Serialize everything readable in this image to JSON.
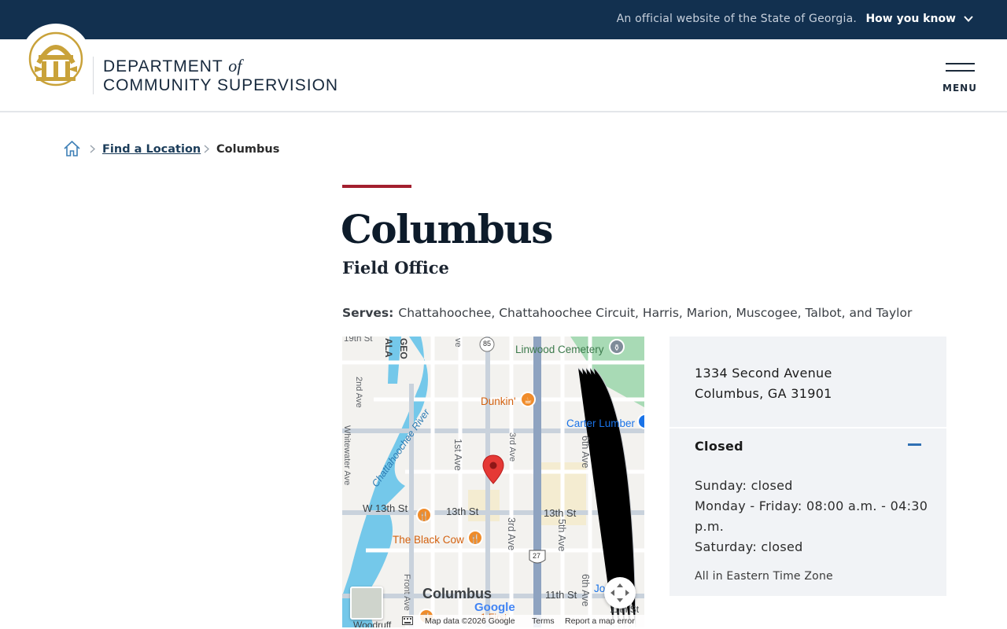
{
  "banner": {
    "official_text": "An official website of the State of Georgia.",
    "how_you_know": "How you know",
    "background_color": "#12304f"
  },
  "header": {
    "dept_line1": "DEPARTMENT",
    "dept_of": "of",
    "dept_line2": "COMMUNITY SUPERVISION",
    "menu_label": "MENU",
    "logo_icon": "georgia-seal-arch-icon"
  },
  "breadcrumb": {
    "home_icon": "home-icon",
    "find_location": "Find a Location",
    "current": "Columbus"
  },
  "page": {
    "title": "Columbus",
    "subtitle": "Field Office",
    "serves_label": "Serves:",
    "serves_value": "Chattahoochee, Chattahoochee Circuit, Harris, Marion, Muscogee, Talbot, and Taylor",
    "accent_color": "#a31f2e"
  },
  "map": {
    "labels": {
      "st19": "19th St",
      "linwood": "Linwood Cemetery",
      "dunkin": "Dunkin'",
      "carter": "Carter Lumber",
      "river": "Chattahoochee River",
      "whitewater": "Whitewater Ave",
      "ave2": "2nd Ave",
      "ave1": "1st Ave",
      "ave3a": "3rd Ave",
      "ave3b": "3rd Ave",
      "ave5": "5th Ave",
      "ave6a": "6th Ave",
      "ave6b": "6th Ave",
      "w13": "W 13th St",
      "st13a": "13th St",
      "st13b": "13th St",
      "blackcow": "The Black Cow",
      "front": "Front Ave",
      "st11a": "11th St",
      "st11b": "11th St",
      "city": "Columbus",
      "john": "Jo",
      "alabama": "ALA",
      "geo": "GEO",
      "ave_top": "ve",
      "route85": "85",
      "route27": "27",
      "woodruff": "Woodruff",
      "frst": "1 First"
    },
    "google_logo": "Google",
    "attribution": {
      "data": "Map data ©2026 Google",
      "terms": "Terms",
      "report": "Report a map error"
    },
    "pin_icon": "location-pin-icon"
  },
  "location": {
    "address_line1": "1334 Second Avenue",
    "address_line2": "Columbus, GA 31901",
    "status": "Closed",
    "hours": [
      "Sunday: closed",
      "Monday - Friday: 08:00 a.m. - 04:30 p.m.",
      "Saturday: closed"
    ],
    "timezone": "All in Eastern Time Zone"
  }
}
